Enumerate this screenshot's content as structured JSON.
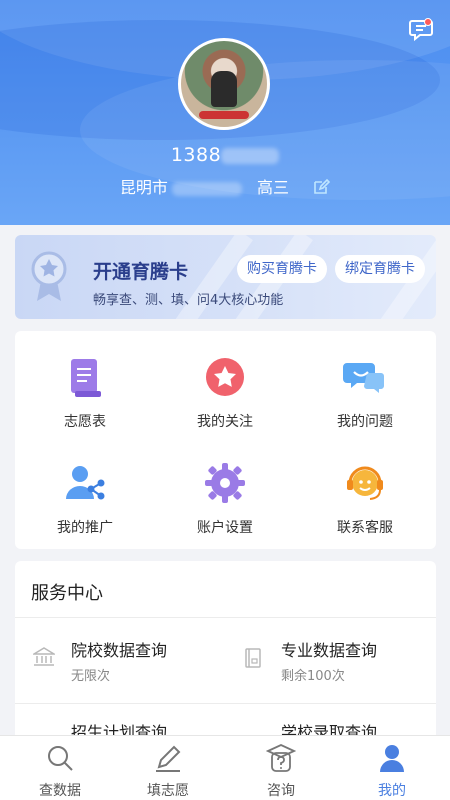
{
  "header": {
    "phone_visible": "1388",
    "city": "昆明市",
    "grade": "高三"
  },
  "vip": {
    "title": "开通育腾卡",
    "subtitle": "畅享查、测、填、问4大核心功能",
    "buy_label": "购买育腾卡",
    "bind_label": "绑定育腾卡"
  },
  "grid": {
    "items": [
      {
        "label": "志愿表",
        "icon": "scroll-icon"
      },
      {
        "label": "我的关注",
        "icon": "star-icon"
      },
      {
        "label": "我的问题",
        "icon": "chat-bubbles-icon"
      },
      {
        "label": "我的推广",
        "icon": "share-user-icon"
      },
      {
        "label": "账户设置",
        "icon": "gear-icon"
      },
      {
        "label": "联系客服",
        "icon": "headset-icon"
      }
    ]
  },
  "services": {
    "title": "服务中心",
    "items": [
      {
        "name": "院校数据查询",
        "note": "无限次",
        "icon": "bank-icon"
      },
      {
        "name": "专业数据查询",
        "note": "剩余100次",
        "icon": "book-icon"
      },
      {
        "name": "招生计划查询"
      },
      {
        "name": "学校录取查询"
      }
    ]
  },
  "tabbar": {
    "tabs": [
      {
        "label": "查数据",
        "icon": "search-icon"
      },
      {
        "label": "填志愿",
        "icon": "pen-icon"
      },
      {
        "label": "咨询",
        "icon": "question-doc-icon"
      },
      {
        "label": "我的",
        "icon": "user-icon"
      }
    ],
    "active": "我的"
  },
  "colors": {
    "header_blue": "#4a8cf0",
    "accent": "#4a7fe0",
    "vip_title": "#2a3e8c"
  }
}
